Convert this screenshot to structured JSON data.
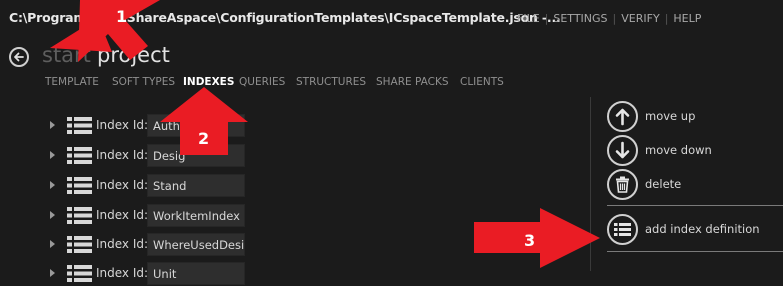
{
  "window": {
    "path": "C:\\Program Files\\ShareAspace\\ConfigurationTemplates\\ICspaceTemplate.json -...",
    "menu": [
      "FILE",
      "SETTINGS",
      "VERIFY",
      "HELP"
    ]
  },
  "breadcrumb": {
    "start": "start",
    "current": "project"
  },
  "tabs": [
    "TEMPLATE",
    "SOFT TYPES",
    "INDEXES",
    "QUERIES",
    "STRUCTURES",
    "SHARE PACKS",
    "CLIENTS"
  ],
  "active_tab": "INDEXES",
  "index_rows": [
    {
      "label": "Index Id:",
      "value": "Auth"
    },
    {
      "label": "Index Id:",
      "value": "Desig"
    },
    {
      "label": "Index Id:",
      "value": "Stand"
    },
    {
      "label": "Index Id:",
      "value": "WorkItemIndex"
    },
    {
      "label": "Index Id:",
      "value": "WhereUsedDesig"
    },
    {
      "label": "Index Id:",
      "value": "Unit"
    }
  ],
  "actions": {
    "move_up": "move up",
    "move_down": "move down",
    "delete": "delete",
    "add_index_definition": "add index definition"
  },
  "annotations": [
    "1",
    "2",
    "3"
  ],
  "colors": {
    "background": "#1b1b1b",
    "annotation_red": "#ea1c24",
    "textbox": "#2e2e2e"
  },
  "icons": [
    "back-arrow-icon",
    "list-icon",
    "arrow-up-icon",
    "arrow-down-icon",
    "trash-icon"
  ]
}
